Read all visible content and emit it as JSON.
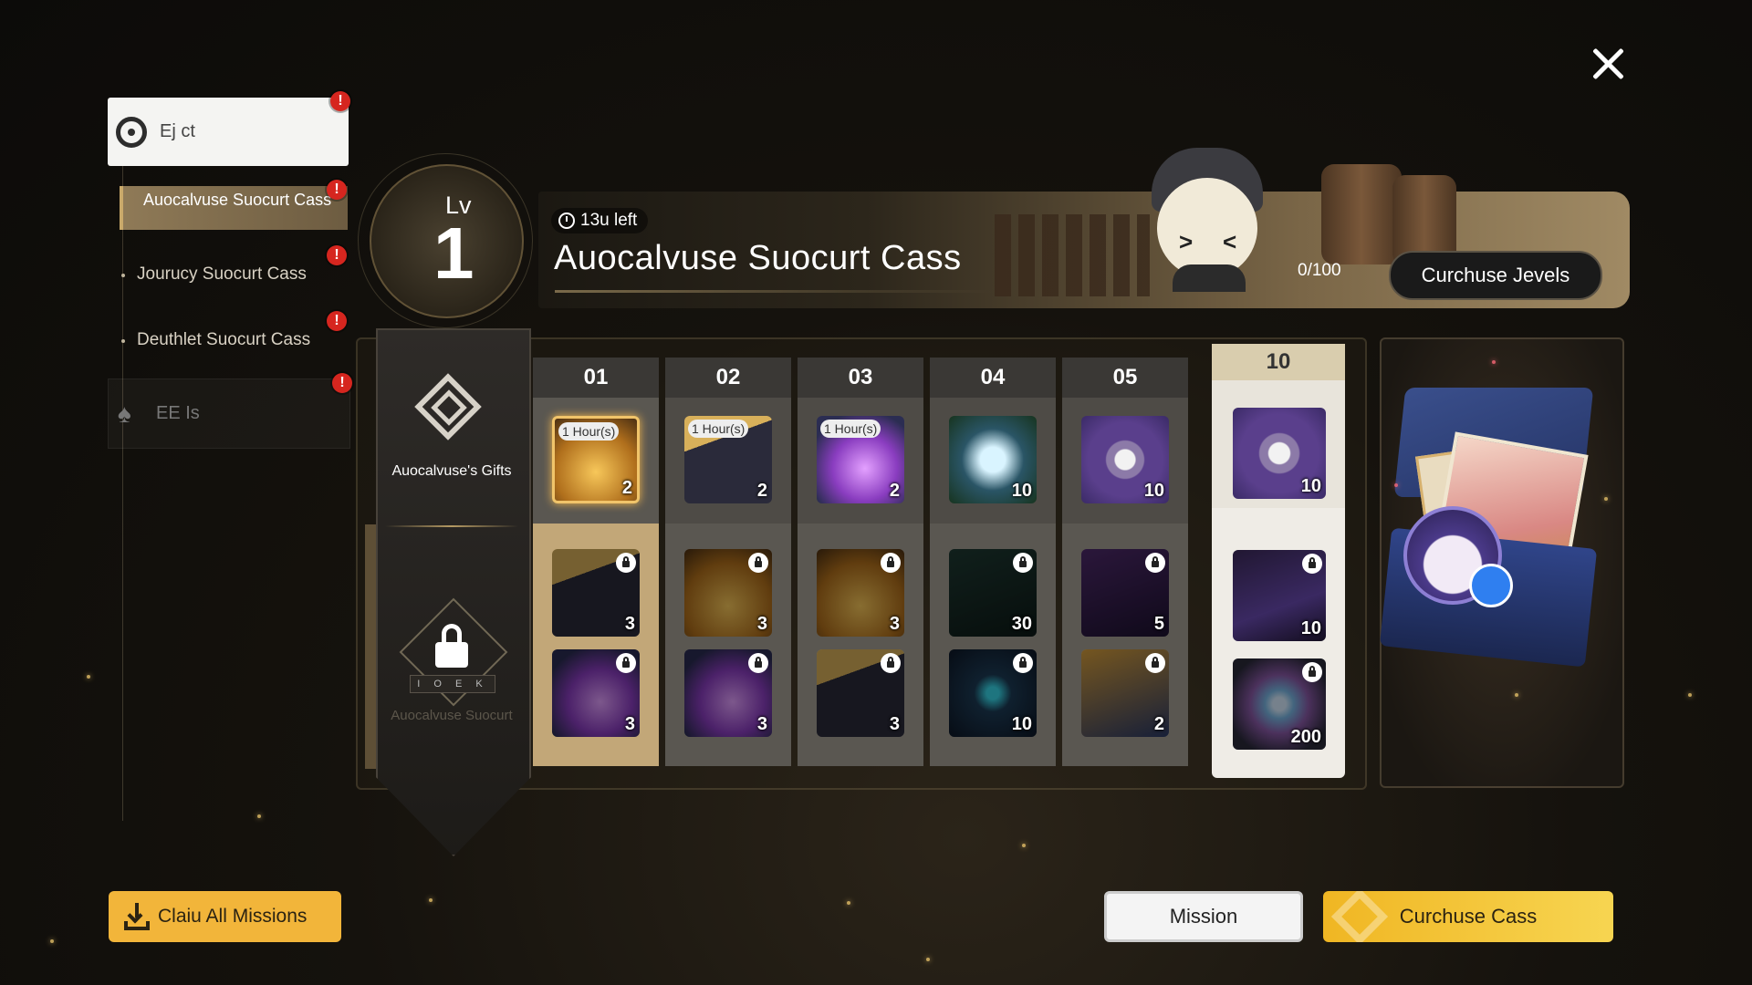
{
  "window": {
    "close_icon": "close-icon"
  },
  "nav": {
    "top": {
      "label": "Ej ct",
      "icon": "compass-icon"
    },
    "items": [
      {
        "label": "Auocalvuse Suocurt Cass",
        "active": true
      },
      {
        "label": "Jourucy Suocurt Cass",
        "active": false
      },
      {
        "label": "Deuthlet Suocurt Cass",
        "active": false
      }
    ],
    "bottom": {
      "label": "EE Is",
      "icon": "flame-icon"
    },
    "badge": "!"
  },
  "level": {
    "prefix": "Lv",
    "value": "1"
  },
  "banner": {
    "timer": "13u left",
    "title": "Auocalvuse Suocurt Cass",
    "progress": "0/100",
    "levels_button": "Curchuse Jevels"
  },
  "rewards": {
    "side_label": "Auocalvuse's Gifts",
    "locked_label": "Auocalvuse Suocurt",
    "lock_strip": "I O E K",
    "columns": [
      {
        "level": "01",
        "free": {
          "qty": "2",
          "tag": "1 Hour(s)",
          "kind": "gold",
          "highlight": true
        },
        "paid": [
          {
            "qty": "3",
            "kind": "chest"
          },
          {
            "qty": "3",
            "kind": "purple-crys"
          }
        ]
      },
      {
        "level": "02",
        "free": {
          "qty": "2",
          "tag": "1 Hour(s)",
          "kind": "chest"
        },
        "paid": [
          {
            "qty": "3",
            "kind": "gold"
          },
          {
            "qty": "3",
            "kind": "purple-crys"
          }
        ]
      },
      {
        "level": "03",
        "free": {
          "qty": "2",
          "tag": "1 Hour(s)",
          "kind": "purple-crys"
        },
        "paid": [
          {
            "qty": "3",
            "kind": "gold"
          },
          {
            "qty": "3",
            "kind": "chest"
          }
        ]
      },
      {
        "level": "04",
        "free": {
          "qty": "10",
          "tag": "",
          "kind": "bar"
        },
        "paid": [
          {
            "qty": "30",
            "kind": "darkbox"
          },
          {
            "qty": "10",
            "kind": "cubeblue"
          }
        ]
      },
      {
        "level": "05",
        "free": {
          "qty": "10",
          "tag": "",
          "kind": "disc"
        },
        "paid": [
          {
            "qty": "5",
            "kind": "purplebox"
          },
          {
            "qty": "2",
            "kind": "ticket"
          }
        ]
      },
      {
        "level": "10",
        "free": {
          "qty": "10",
          "tag": "",
          "kind": "disc"
        },
        "paid": [
          {
            "qty": "10",
            "kind": "purplechest"
          },
          {
            "qty": "200",
            "kind": "starcrys"
          }
        ]
      }
    ]
  },
  "buttons": {
    "claim_all": "Claiu All Missions",
    "mission": "Mission",
    "purchase": "Curchuse Cass"
  }
}
